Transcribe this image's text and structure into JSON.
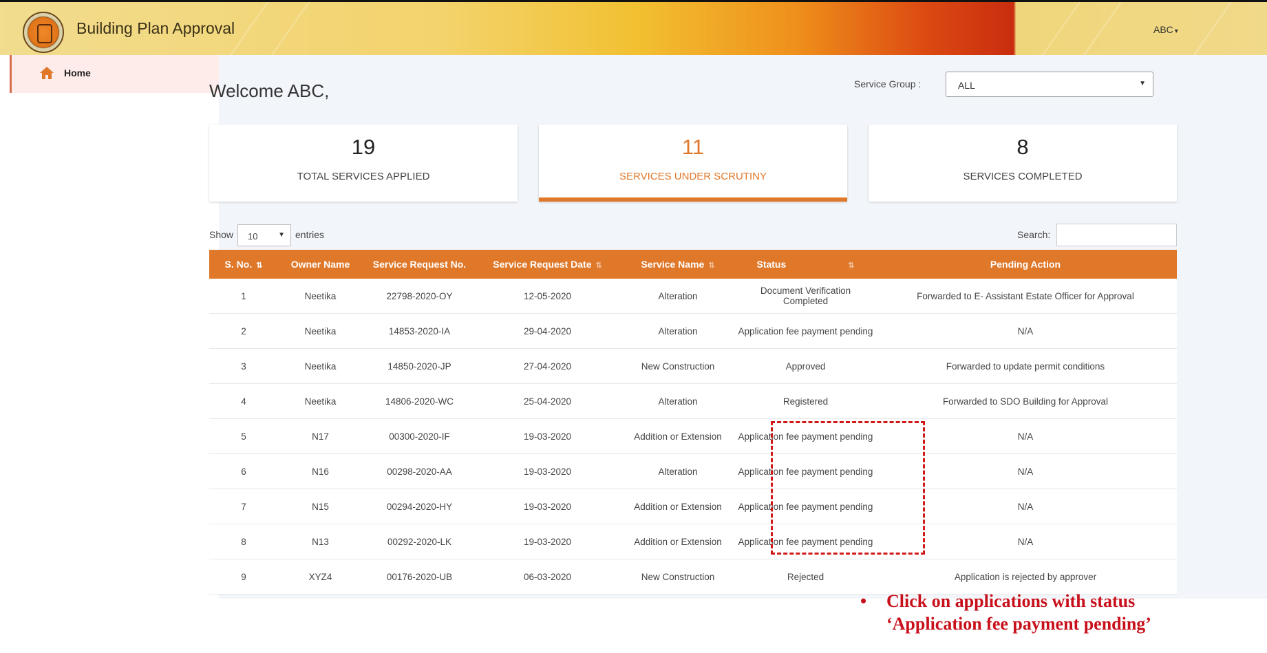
{
  "header": {
    "app_title": "Building Plan Approval",
    "user": "ABC",
    "user_caret": "▾"
  },
  "sidebar": {
    "items": [
      {
        "label": "Home",
        "icon": "home-icon"
      }
    ]
  },
  "main": {
    "welcome": "Welcome ABC,",
    "service_group": {
      "label": "Service Group :",
      "value": "ALL",
      "arrow": "▼"
    },
    "cards": [
      {
        "value": "19",
        "label": "TOTAL SERVICES APPLIED"
      },
      {
        "value": "11",
        "label": "SERVICES UNDER SCRUTINY"
      },
      {
        "value": "8",
        "label": "SERVICES COMPLETED"
      }
    ],
    "table_controls": {
      "show_label": "Show",
      "entries_value": "10",
      "entries_label": "entries",
      "search_label": "Search:",
      "search_value": ""
    },
    "table": {
      "columns": [
        "S. No.",
        "Owner Name",
        "Service Request No.",
        "Service Request Date",
        "Service Name",
        "Status",
        "Pending Action"
      ],
      "rows": [
        [
          "1",
          "Neetika",
          "22798-2020-OY",
          "12-05-2020",
          "Alteration",
          "Document Verification Completed",
          "Forwarded to E- Assistant Estate Officer for Approval"
        ],
        [
          "2",
          "Neetika",
          "14853-2020-IA",
          "29-04-2020",
          "Alteration",
          "Application fee payment pending",
          "N/A"
        ],
        [
          "3",
          "Neetika",
          "14850-2020-JP",
          "27-04-2020",
          "New Construction",
          "Approved",
          "Forwarded to update permit conditions"
        ],
        [
          "4",
          "Neetika",
          "14806-2020-WC",
          "25-04-2020",
          "Alteration",
          "Registered",
          "Forwarded to SDO Building for Approval"
        ],
        [
          "5",
          "N17",
          "00300-2020-IF",
          "19-03-2020",
          "Addition or Extension",
          "Application fee payment pending",
          "N/A"
        ],
        [
          "6",
          "N16",
          "00298-2020-AA",
          "19-03-2020",
          "Alteration",
          "Application fee payment pending",
          "N/A"
        ],
        [
          "7",
          "N15",
          "00294-2020-HY",
          "19-03-2020",
          "Addition or Extension",
          "Application fee payment pending",
          "N/A"
        ],
        [
          "8",
          "N13",
          "00292-2020-LK",
          "19-03-2020",
          "Addition or Extension",
          "Application fee payment pending",
          "N/A"
        ],
        [
          "9",
          "XYZ4",
          "00176-2020-UB",
          "06-03-2020",
          "New Construction",
          "Rejected",
          "Application is rejected by approver"
        ]
      ]
    }
  },
  "annotation": {
    "bullet": "•",
    "line1": "Click on applications with status",
    "line2": "‘Application fee payment pending’"
  },
  "colors": {
    "accent": "#e0782a",
    "highlight": "#d11818",
    "callout": "#c8101b"
  }
}
